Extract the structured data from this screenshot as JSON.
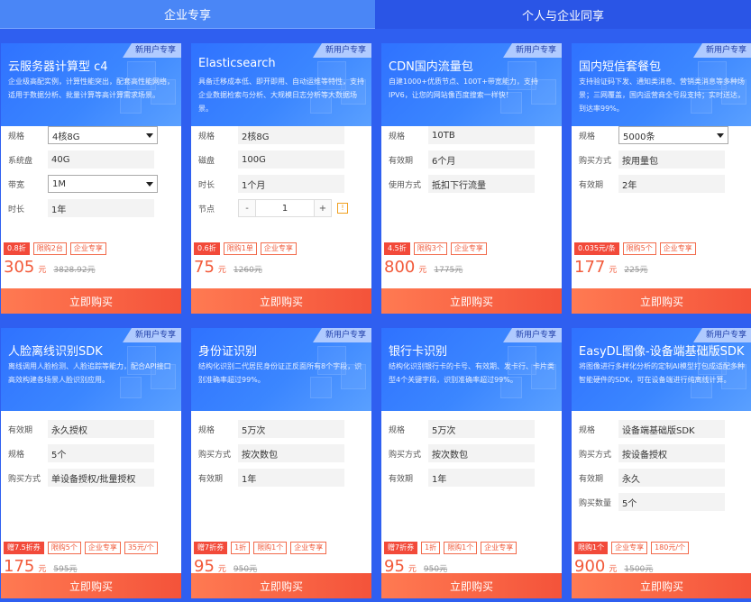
{
  "tabs": [
    {
      "label": "企业专享",
      "active": true
    },
    {
      "label": "个人与企业同享",
      "active": false
    }
  ],
  "new_badge": "新用户专享",
  "buy_label": "立即购买",
  "unit": "元",
  "colors": {
    "accent": "#2f72ff",
    "price": "#f25a3a",
    "buy": "#f4533a"
  },
  "cards": [
    {
      "title": "云服务器计算型 c4",
      "desc": "企业级高配实例，计算性能突出，配套高性能网络，适用于数据分析、批量计算等高计算需求场景。",
      "specs": [
        {
          "label": "规格",
          "value": "4核8G",
          "type": "select"
        },
        {
          "label": "系统盘",
          "value": "40G",
          "type": "text"
        },
        {
          "label": "带宽",
          "value": "1M",
          "type": "select"
        },
        {
          "label": "时长",
          "value": "1年",
          "type": "text"
        }
      ],
      "tags": [
        {
          "text": "0.8折",
          "solid": true
        },
        {
          "text": "限购2台"
        },
        {
          "text": "企业专享"
        }
      ],
      "price": "305",
      "orig": "3828.92元"
    },
    {
      "title": "Elasticsearch",
      "desc": "具备迁移成本低、即开即用、自动运维等特性，支持企业数据检索与分析、大规模日志分析等大数据场景。",
      "specs": [
        {
          "label": "规格",
          "value": "2核8G",
          "type": "text"
        },
        {
          "label": "磁盘",
          "value": "100G",
          "type": "text"
        },
        {
          "label": "时长",
          "value": "1个月",
          "type": "text"
        },
        {
          "label": "节点",
          "value": "1",
          "type": "stepper",
          "minus": "-",
          "plus": "+",
          "warn": "!"
        }
      ],
      "tags": [
        {
          "text": "0.6折",
          "solid": true
        },
        {
          "text": "限购1单"
        },
        {
          "text": "企业专享"
        }
      ],
      "price": "75",
      "orig": "1260元"
    },
    {
      "title": "CDN国内流量包",
      "desc": "自建1000+优质节点、100T+带宽能力，支持IPV6，让您的网站像百度搜索一样快！",
      "specs": [
        {
          "label": "规格",
          "value": "10TB",
          "type": "text"
        },
        {
          "label": "有效期",
          "value": "6个月",
          "type": "text"
        },
        {
          "label": "使用方式",
          "value": "抵扣下行流量",
          "type": "text"
        }
      ],
      "tags": [
        {
          "text": "4.5折",
          "solid": true
        },
        {
          "text": "限购3个"
        },
        {
          "text": "企业专享"
        }
      ],
      "price": "800",
      "orig": "1775元"
    },
    {
      "title": "国内短信套餐包",
      "desc": "支持验证码下发、通知类消息、营销类消息等多种场景；三网覆盖，国内运营商全号段支持；实时送达，到达率99%。",
      "specs": [
        {
          "label": "规格",
          "value": "5000条",
          "type": "select"
        },
        {
          "label": "购买方式",
          "value": "按用量包",
          "type": "text"
        },
        {
          "label": "有效期",
          "value": "2年",
          "type": "text"
        }
      ],
      "tags": [
        {
          "text": "0.035元/条",
          "solid": true
        },
        {
          "text": "限购5个"
        },
        {
          "text": "企业专享"
        }
      ],
      "price": "177",
      "orig": "225元"
    },
    {
      "title": "人脸离线识别SDK",
      "desc": "离线调用人脸检测、人脸追踪等能力，配合API接口高效构建各场景人脸识别应用。",
      "specs": [
        {
          "label": "有效期",
          "value": "永久授权",
          "type": "text"
        },
        {
          "label": "规格",
          "value": "5个",
          "type": "text"
        },
        {
          "label": "购买方式",
          "value": "单设备授权/批量授权",
          "type": "text"
        }
      ],
      "tags": [
        {
          "text": "赠7.5折券",
          "solid": true
        },
        {
          "text": "限购5个"
        },
        {
          "text": "企业专享"
        },
        {
          "text": "35元/个"
        }
      ],
      "price": "175",
      "orig": "595元"
    },
    {
      "title": "身份证识别",
      "desc": "结构化识别二代居民身份证正反面所有8个字段，识别准确率超过99%。",
      "specs": [
        {
          "label": "规格",
          "value": "5万次",
          "type": "text"
        },
        {
          "label": "购买方式",
          "value": "按次数包",
          "type": "text"
        },
        {
          "label": "有效期",
          "value": "1年",
          "type": "text"
        }
      ],
      "tags": [
        {
          "text": "赠7折券",
          "solid": true
        },
        {
          "text": "1折"
        },
        {
          "text": "限购1个"
        },
        {
          "text": "企业专享"
        }
      ],
      "price": "95",
      "orig": "950元"
    },
    {
      "title": "银行卡识别",
      "desc": "结构化识别银行卡的卡号、有效期、发卡行、卡片类型4个关键字段，识别准确率超过99%。",
      "specs": [
        {
          "label": "规格",
          "value": "5万次",
          "type": "text"
        },
        {
          "label": "购买方式",
          "value": "按次数包",
          "type": "text"
        },
        {
          "label": "有效期",
          "value": "1年",
          "type": "text"
        }
      ],
      "tags": [
        {
          "text": "赠7折券",
          "solid": true
        },
        {
          "text": "1折"
        },
        {
          "text": "限购1个"
        },
        {
          "text": "企业专享"
        }
      ],
      "price": "95",
      "orig": "950元"
    },
    {
      "title": "EasyDL图像-设备端基础版SDK",
      "desc": "将图像进行多样化分析的定制AI模型打包成适配多种智能硬件的SDK，可在设备端进行纯离线计算。",
      "specs": [
        {
          "label": "规格",
          "value": "设备端基础版SDK",
          "type": "text"
        },
        {
          "label": "购买方式",
          "value": "按设备授权",
          "type": "text"
        },
        {
          "label": "有效期",
          "value": "永久",
          "type": "text"
        },
        {
          "label": "购买数量",
          "value": "5个",
          "type": "text"
        }
      ],
      "tags": [
        {
          "text": "限购1个",
          "solid": true
        },
        {
          "text": "企业专享"
        },
        {
          "text": "180元/个"
        }
      ],
      "price": "900",
      "orig": "1500元"
    }
  ]
}
